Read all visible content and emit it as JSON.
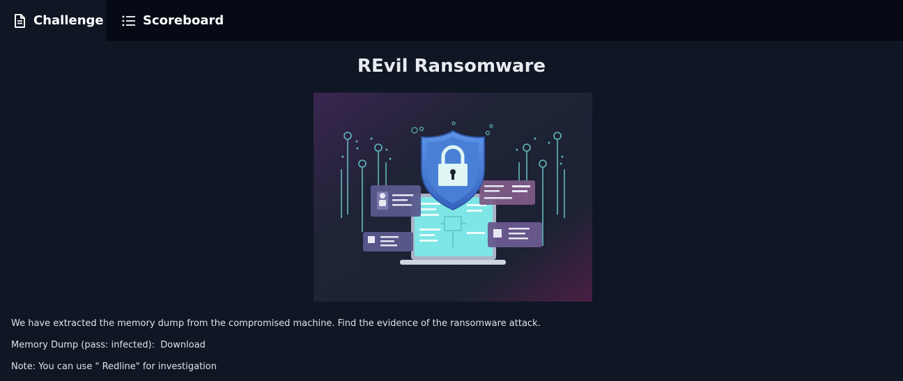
{
  "nav": {
    "tabs": [
      {
        "label": "Challenge",
        "icon": "document-icon",
        "active": true
      },
      {
        "label": "Scoreboard",
        "icon": "list-icon",
        "active": false
      }
    ]
  },
  "challenge": {
    "title": "REvil Ransomware",
    "description": "We have extracted the memory dump from the compromised machine. Find the evidence of the ransomware attack.",
    "memory_dump_label": "Memory Dump (pass: infected):",
    "download_label": "Download",
    "note": "Note: You can use \" Redline\" for investigation"
  },
  "colors": {
    "background": "#0f1724",
    "topbar": "#050a14",
    "shield": "#4a7fd6",
    "screen": "#7ee6e6",
    "card": "#5c5a8a"
  }
}
